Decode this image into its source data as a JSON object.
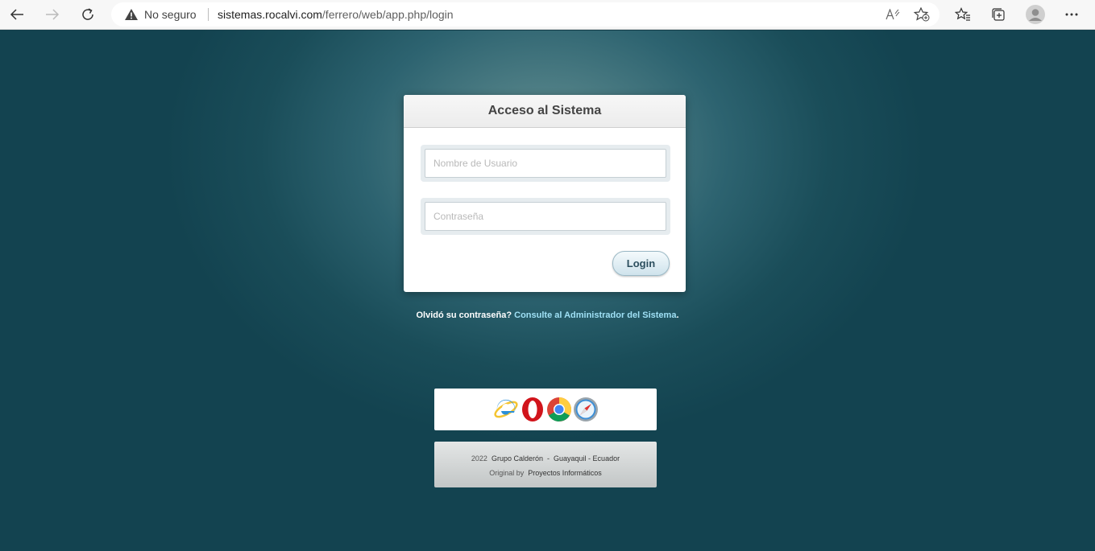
{
  "browser": {
    "security_label": "No seguro",
    "url_host": "sistemas.rocalvi.com",
    "url_path": "/ferrero/web/app.php/login",
    "icons": [
      "back-icon",
      "forward-icon",
      "refresh-icon",
      "warning-icon",
      "read-aloud-icon",
      "add-favorite-icon",
      "favorites-icon",
      "collections-icon",
      "profile-icon",
      "more-icon"
    ]
  },
  "login": {
    "title": "Acceso al Sistema",
    "username_placeholder": "Nombre de Usuario",
    "password_placeholder": "Contraseña",
    "submit_label": "Login"
  },
  "forgot": {
    "question": "Olvidó su contraseña?",
    "link_text": "Consulte al Administrador del Sistema",
    "trailing": "."
  },
  "supported_browsers": [
    "internet-explorer-icon",
    "opera-icon",
    "chrome-icon",
    "safari-icon"
  ],
  "footer": {
    "year": "2022",
    "company": "Grupo Calderón",
    "dash": "-",
    "location": "Guayaquil - Ecuador",
    "original_by": "Original by",
    "author": "Proyectos Informáticos"
  },
  "colors": {
    "background": "#143f4b",
    "link": "#9fe0f5",
    "card": "#ffffff"
  }
}
